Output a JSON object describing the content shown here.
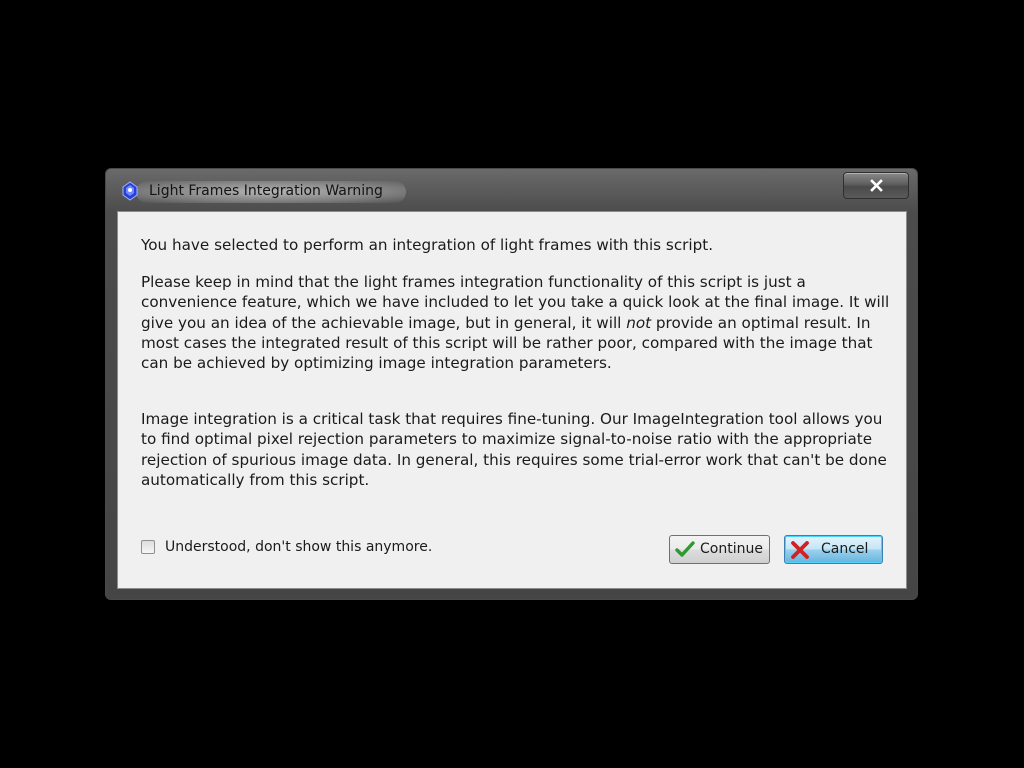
{
  "window": {
    "title": "Light Frames Integration Warning",
    "icon": "pixinsight-app-icon",
    "close_icon": "close-icon"
  },
  "message": {
    "para1": "You have selected to perform an integration of light frames with this script.",
    "para2_before": "Please keep in mind that the light frames integration functionality of this script is just a convenience feature, which we have included to let you take a quick look at the final image. It will give you an idea of the achievable image, but in general, it will ",
    "para2_emphasis": "not",
    "para2_after": " provide an optimal result. In most cases the integrated result of this script will be rather poor, compared with the image that can be achieved by optimizing image integration parameters.",
    "para3": "Image integration is a critical task that requires fine-tuning. Our ImageIntegration tool allows you to find optimal pixel rejection parameters to maximize signal-to-noise ratio with the appropriate rejection of spurious image data. In general, this requires some trial-error work that can't be done automatically from this script."
  },
  "checkbox": {
    "label": "Understood, don't show this anymore.",
    "checked": false
  },
  "buttons": {
    "continue_label": "Continue",
    "continue_icon": "checkmark-icon",
    "cancel_label": "Cancel",
    "cancel_icon": "red-x-icon"
  },
  "colors": {
    "checkmark": "#2e9a2e",
    "cancel_x": "#d42020",
    "focus_blue": "#48d4ff"
  }
}
